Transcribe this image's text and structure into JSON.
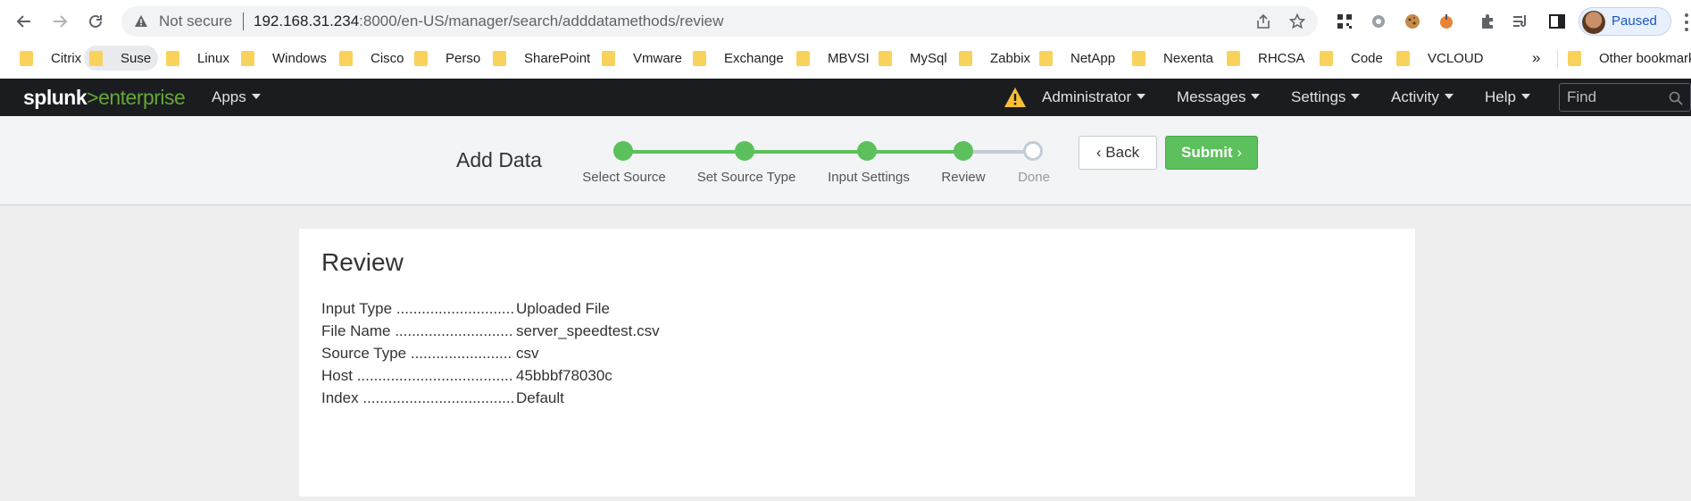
{
  "browser": {
    "security_label": "Not secure",
    "url_host": "192.168.31.234",
    "url_rest": ":8000/en-US/manager/search/adddatamethods/review",
    "profile_label": "Paused"
  },
  "bookmarks": [
    {
      "label": "Citrix"
    },
    {
      "label": "Suse"
    },
    {
      "label": "Linux"
    },
    {
      "label": "Windows"
    },
    {
      "label": "Cisco"
    },
    {
      "label": "Perso"
    },
    {
      "label": "SharePoint"
    },
    {
      "label": "Vmware"
    },
    {
      "label": "Exchange"
    },
    {
      "label": "MBVSI"
    },
    {
      "label": "MySql"
    },
    {
      "label": "Zabbix"
    },
    {
      "label": "NetApp"
    },
    {
      "label": "Nexenta"
    },
    {
      "label": "RHCSA"
    },
    {
      "label": "Code"
    },
    {
      "label": "VCLOUD"
    }
  ],
  "bookmarks_more": "»",
  "other_bookmarks": "Other bookmarks",
  "splunk": {
    "logo_main": "splunk",
    "logo_gt": ">",
    "logo_product": "enterprise",
    "menu": {
      "apps": "Apps",
      "administrator": "Administrator",
      "messages": "Messages",
      "settings": "Settings",
      "activity": "Activity",
      "help": "Help"
    },
    "find_placeholder": "Find"
  },
  "wizard": {
    "title": "Add Data",
    "steps": [
      {
        "label": "Select Source",
        "state": "complete"
      },
      {
        "label": "Set Source Type",
        "state": "complete"
      },
      {
        "label": "Input Settings",
        "state": "complete"
      },
      {
        "label": "Review",
        "state": "current"
      },
      {
        "label": "Done",
        "state": "pending"
      }
    ],
    "back_label": "Back",
    "submit_label": "Submit"
  },
  "review": {
    "heading": "Review",
    "rows": [
      {
        "key": "Input Type",
        "value": "Uploaded File"
      },
      {
        "key": "File Name",
        "value": "server_speedtest.csv"
      },
      {
        "key": "Source Type",
        "value": "csv"
      },
      {
        "key": "Host",
        "value": "45bbbf78030c"
      },
      {
        "key": "Index",
        "value": "Default"
      }
    ]
  },
  "colors": {
    "splunk_green": "#5cc05c",
    "header_bg": "#1a1c20",
    "warning": "#f8be34"
  }
}
